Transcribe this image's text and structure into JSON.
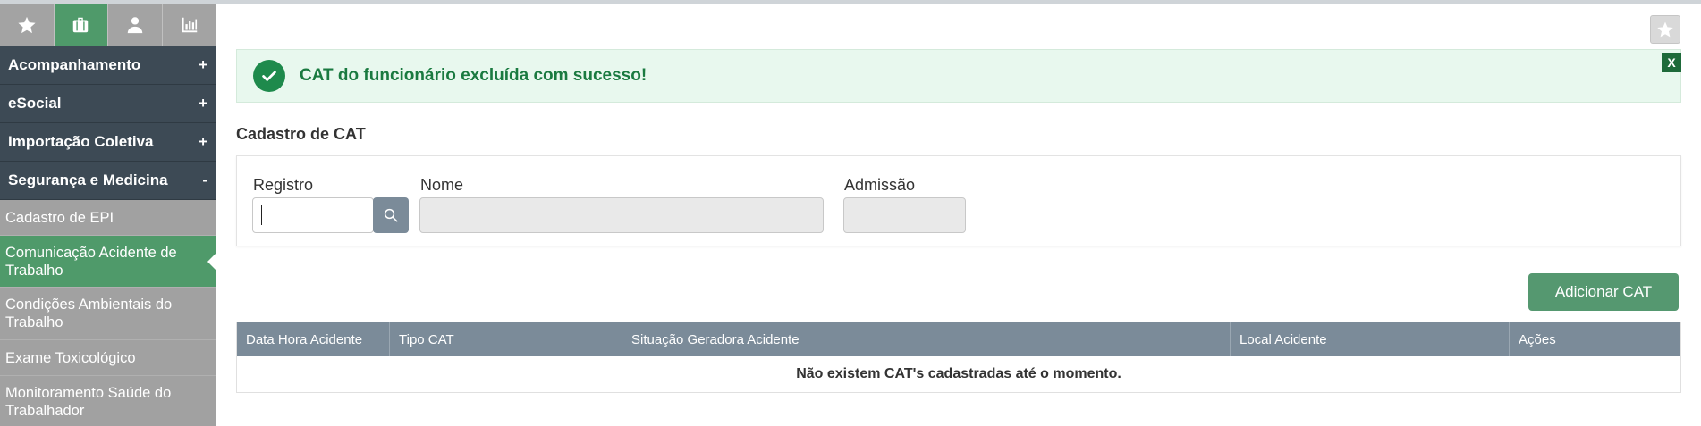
{
  "sidebar": {
    "icons": [
      {
        "name": "star-icon",
        "active": false
      },
      {
        "name": "briefcase-icon",
        "active": true
      },
      {
        "name": "person-icon",
        "active": false
      },
      {
        "name": "bar-chart-icon",
        "active": false
      }
    ],
    "groups": [
      {
        "label": "Acompanhamento",
        "sign": "+"
      },
      {
        "label": "eSocial",
        "sign": "+"
      },
      {
        "label": "Importação Coletiva",
        "sign": "+"
      },
      {
        "label": "Segurança e Medicina",
        "sign": "-"
      }
    ],
    "items": [
      {
        "label": "Cadastro de EPI",
        "active": false
      },
      {
        "label": "Comunicação Acidente de Trabalho",
        "active": true
      },
      {
        "label": "Condições Ambientais do Trabalho",
        "active": false
      },
      {
        "label": "Exame Toxicológico",
        "active": false
      },
      {
        "label": "Monitoramento Saúde do Trabalhador",
        "active": false
      }
    ]
  },
  "alert": {
    "message": "CAT do funcionário excluída com sucesso!",
    "close_label": "X"
  },
  "form": {
    "title": "Cadastro de CAT",
    "registro_label": "Registro",
    "registro_value": "",
    "nome_label": "Nome",
    "nome_value": "",
    "admissao_label": "Admissão",
    "admissao_value": ""
  },
  "add_button_label": "Adicionar CAT",
  "table": {
    "columns": [
      "Data Hora Acidente",
      "Tipo CAT",
      "Situação Geradora Acidente",
      "Local Acidente",
      "Ações"
    ],
    "empty_message": "Não existem CAT's cadastradas até o momento."
  },
  "colors": {
    "accent_green": "#4f9a6a",
    "sidebar_dark": "#3d4a55",
    "table_header": "#7b8b99",
    "alert_bg": "#e8f8ee",
    "alert_text": "#1a7a40"
  }
}
